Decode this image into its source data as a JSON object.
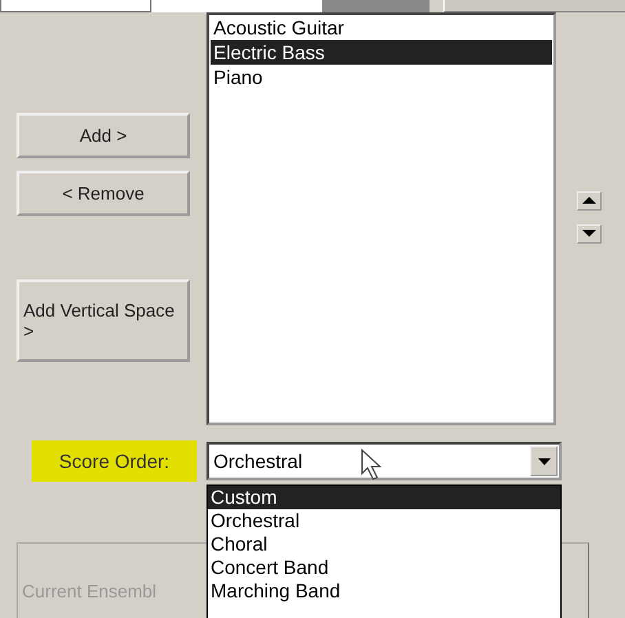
{
  "instruments": [
    {
      "label": "Acoustic Guitar",
      "selected": false
    },
    {
      "label": "Electric Bass",
      "selected": true
    },
    {
      "label": "Piano",
      "selected": false
    }
  ],
  "buttons": [
    {
      "label": "Add >"
    },
    {
      "label": "< Remove"
    },
    {
      "label": "Add Vertical Space >"
    }
  ],
  "score_order": {
    "label": "Score Order:",
    "value": "Orchestral",
    "expanded": true,
    "options": [
      {
        "label": "Custom",
        "highlighted": true
      },
      {
        "label": "Orchestral",
        "highlighted": false
      },
      {
        "label": "Choral",
        "highlighted": false
      },
      {
        "label": "Concert Band",
        "highlighted": false
      },
      {
        "label": "Marching Band",
        "highlighted": false
      }
    ]
  },
  "current_ensemble": {
    "label": "Current Ensembl"
  }
}
